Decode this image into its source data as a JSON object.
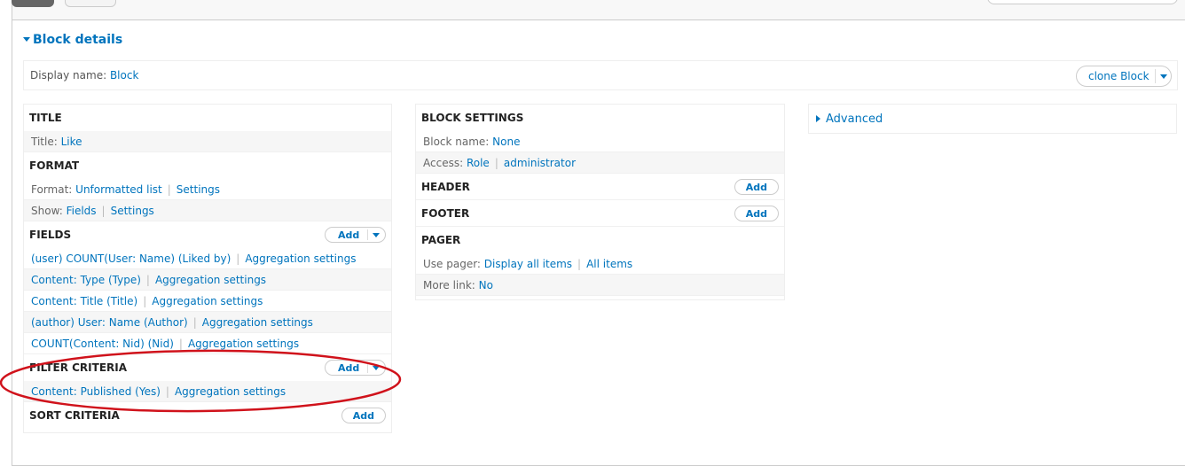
{
  "header": {
    "section_title": "Block details"
  },
  "display": {
    "label": "Display name:",
    "value": "Block",
    "clone_button": "clone Block"
  },
  "column1": {
    "title": {
      "heading": "TITLE",
      "row": {
        "label": "Title:",
        "value": "Like"
      }
    },
    "format": {
      "heading": "FORMAT",
      "rows": [
        {
          "label": "Format:",
          "value": "Unformatted list",
          "action": "Settings"
        },
        {
          "label": "Show:",
          "value": "Fields",
          "action": "Settings"
        }
      ]
    },
    "fields": {
      "heading": "FIELDS",
      "add_label": "Add",
      "items": [
        {
          "name": "(user) COUNT(User: Name) (Liked by)",
          "action": "Aggregation settings"
        },
        {
          "name": "Content: Type (Type)",
          "action": "Aggregation settings"
        },
        {
          "name": "Content: Title (Title)",
          "action": "Aggregation settings"
        },
        {
          "name": "(author) User: Name (Author)",
          "action": "Aggregation settings"
        },
        {
          "name": "COUNT(Content: Nid) (Nid)",
          "action": "Aggregation settings"
        }
      ]
    },
    "filter": {
      "heading": "FILTER CRITERIA",
      "add_label": "Add",
      "items": [
        {
          "name": "Content: Published (Yes)",
          "action": "Aggregation settings"
        }
      ]
    },
    "sort": {
      "heading": "SORT CRITERIA",
      "add_label": "Add"
    }
  },
  "column2": {
    "block_settings": {
      "heading": "BLOCK SETTINGS",
      "block_name": {
        "label": "Block name:",
        "value": "None"
      },
      "access": {
        "label": "Access:",
        "value": "Role",
        "action": "administrator"
      }
    },
    "header": {
      "heading": "HEADER",
      "add_label": "Add"
    },
    "footer": {
      "heading": "FOOTER",
      "add_label": "Add"
    },
    "pager": {
      "heading": "PAGER",
      "use_pager": {
        "label": "Use pager:",
        "value": "Display all items",
        "action": "All items"
      },
      "more_link": {
        "label": "More link:",
        "value": "No"
      }
    }
  },
  "column3": {
    "advanced_label": "Advanced"
  },
  "colors": {
    "link": "#0074bd",
    "annotation": "#d0121b"
  }
}
